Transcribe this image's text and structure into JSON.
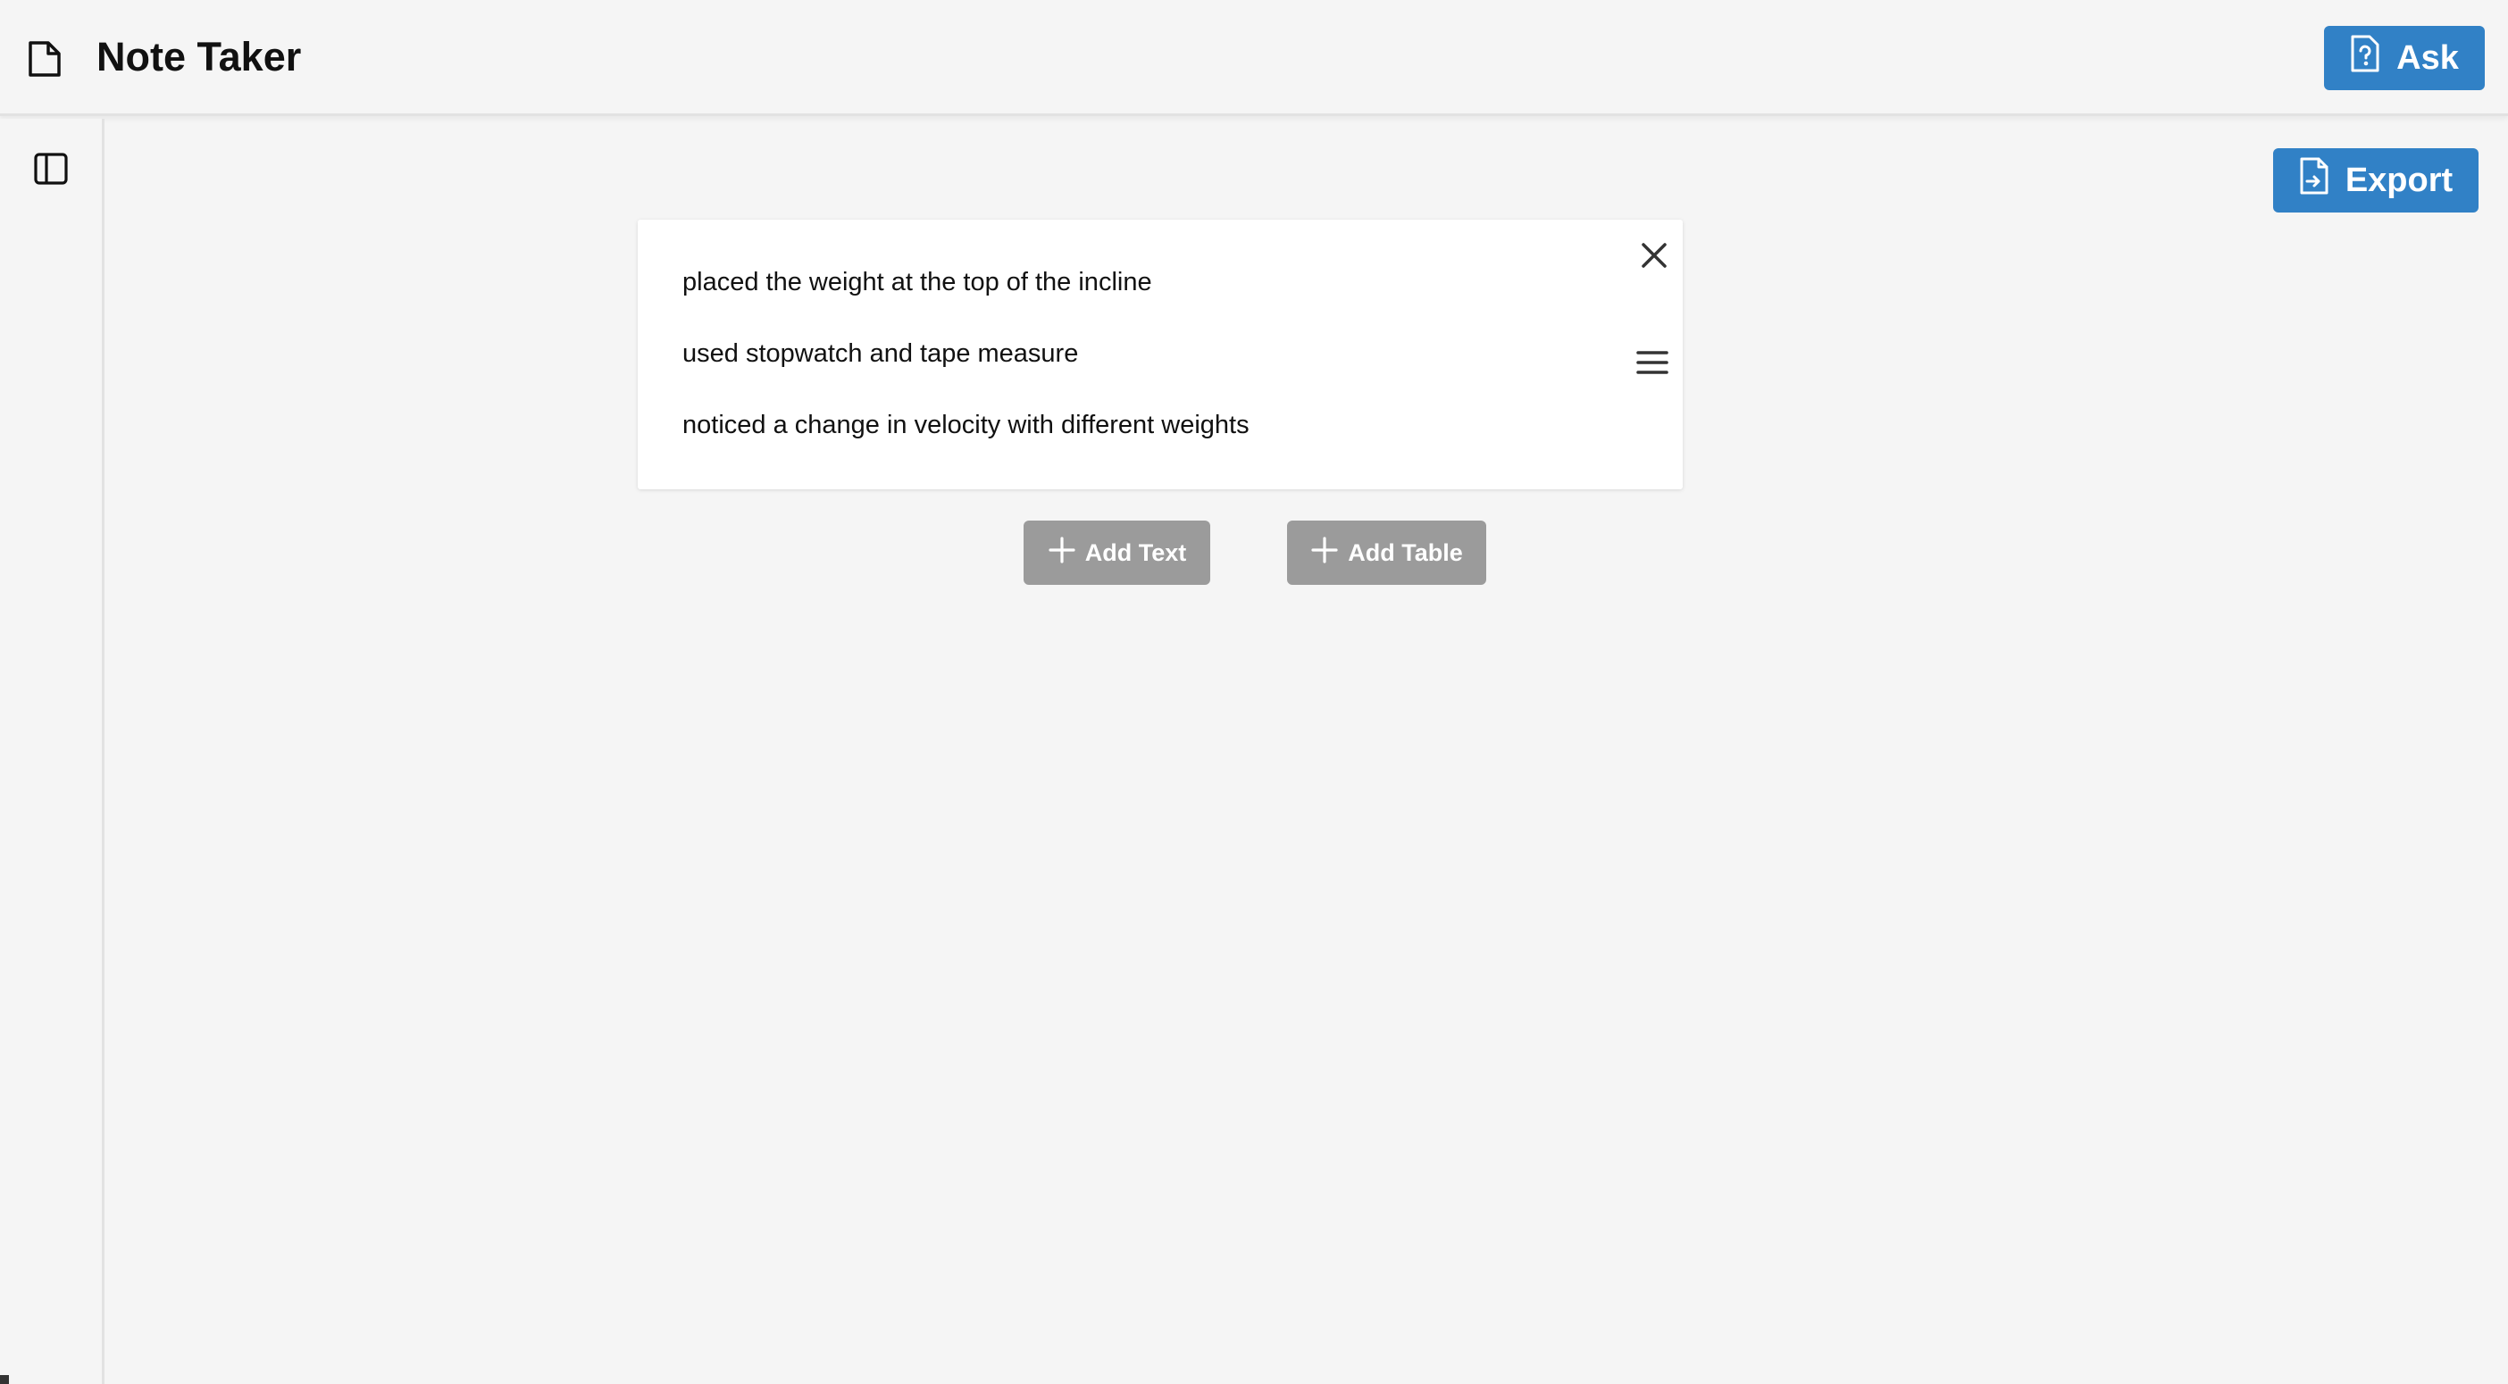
{
  "header": {
    "app_icon": "document-icon",
    "title": "Note Taker",
    "ask_label": "Ask",
    "ask_icon": "help-document-icon"
  },
  "sidebar": {
    "toggle_icon": "sidebar-panel-icon"
  },
  "toolbar": {
    "export_label": "Export",
    "export_icon": "export-document-icon"
  },
  "note_card": {
    "lines": [
      "placed the weight at the top of the incline",
      "used stopwatch and tape measure",
      "noticed a change in velocity with different weights"
    ],
    "close_icon": "close-icon",
    "menu_icon": "drag-menu-icon"
  },
  "actions": {
    "add_text_label": "Add Text",
    "add_table_label": "Add Table",
    "add_icon": "plus-icon"
  },
  "colors": {
    "primary": "#3181c6",
    "disabled": "#9b9b9b",
    "background": "#f5f5f5",
    "card": "#ffffff"
  }
}
